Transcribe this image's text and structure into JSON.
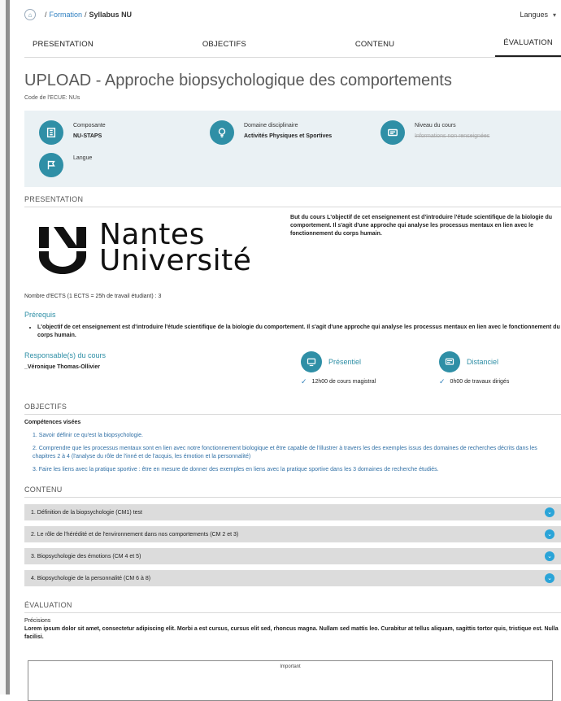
{
  "breadcrumb": {
    "home_icon": "home-icon",
    "separator": "/",
    "link": "Formation",
    "current": "Syllabus NU"
  },
  "language_selector": {
    "label": "Langues",
    "icon": "chevron-down-icon"
  },
  "tabs": [
    {
      "label": "PRESENTATION"
    },
    {
      "label": "OBJECTIFS"
    },
    {
      "label": "CONTENU"
    },
    {
      "label": "ÉVALUATION"
    }
  ],
  "page": {
    "title": "UPLOAD - Approche biopsychologique des comportements",
    "code": "Code de l'ECUE: NUs"
  },
  "info": {
    "items": [
      {
        "label": "Composante",
        "value": "NU-STAPS",
        "icon": "building-icon"
      },
      {
        "label": "Domaine disciplinaire",
        "value": "Activités Physiques et Sportives",
        "icon": "lightbulb-icon"
      },
      {
        "label": "Niveau du cours",
        "value": "Informations non renseignées",
        "icon": "level-icon"
      },
      {
        "label": "Langue",
        "value": "",
        "icon": "flag-icon"
      }
    ]
  },
  "presentation": {
    "heading": "PRESENTATION",
    "logo": {
      "line1": "Nantes",
      "line2": "Université"
    },
    "description": "But du cours L'objectif de cet enseignement est d'introduire l'étude scientifique de la biologie du comportement. Il s'agit d'une approche qui analyse les processus mentaux en lien avec le fonctionnement du corps humain.",
    "ects": "Nombre d'ECTS (1 ECTS = 25h de travail étudiant) : 3",
    "prereq_heading": "Prérequis",
    "prereq_items": [
      "L'objectif de cet enseignement est d'introduire l'étude scientifique de la biologie du comportement. Il s'agit d'une approche qui analyse les processus mentaux en lien avec le fonctionnement du corps humain."
    ],
    "resp_heading": "Responsable(s) du cours",
    "resp_name": "_Véronique Thomas-Ollivier",
    "modalities": [
      {
        "title": "Présentiel",
        "detail": "12h00 de cours magistral",
        "icon": "presentiel-icon"
      },
      {
        "title": "Distanciel",
        "detail": "0h00 de travaux dirigés",
        "icon": "distanciel-icon"
      }
    ]
  },
  "objectifs": {
    "heading": "OBJECTIFS",
    "competences_heading": "Compétences visées",
    "items": [
      "1. Savoir définir ce qu'est la biopsychologie.",
      "2. Comprendre que les processus mentaux sont en lien avec notre fonctionnement biologique et être capable de l'illustrer à travers les des exemples issus des domaines de recherches décrits dans les chapitres 2 à 4 (l'analyse du rôle de l'inné et de l'acquis, les émotion et la personnalité)",
      "3. Faire les liens avec la pratique sportive : être en mesure de donner des exemples en liens avec la pratique sportive dans les 3 domaines de recherche étudiés."
    ]
  },
  "contenu": {
    "heading": "CONTENU",
    "items": [
      {
        "label": "1. Définition de la biopsychologie (CM1) test"
      },
      {
        "label": "2. Le rôle de l'hérédité et de l'environnement dans nos comportements (CM 2 et 3)"
      },
      {
        "label": "3. Biopsychologie des émotions (CM 4 et 5)"
      },
      {
        "label": "4. Biopsychologie de la personnalité (CM 6 à 8)"
      }
    ]
  },
  "evaluation": {
    "heading": "ÉVALUATION",
    "precisions_heading": "Précisions",
    "precisions_text": "Lorem ipsum dolor sit amet, consectetur adipiscing elit. Morbi a est cursus, cursus elit sed, rhoncus magna. Nullam sed mattis leo. Curabitur at tellus aliquam, sagittis tortor quis, tristique est. Nulla facilisi.",
    "important_label": "Important"
  },
  "colors": {
    "accent": "#2f8fa6",
    "link": "#2f80c2",
    "accordion_toggle": "#2aa4d8"
  }
}
